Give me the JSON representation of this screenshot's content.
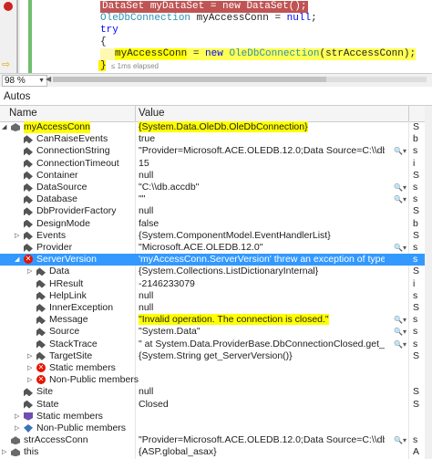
{
  "editor": {
    "line1": {
      "type": "DataSet",
      "rest": " myDataSet = ",
      "kw": "new",
      "type2": " DataSet",
      "end": "();"
    },
    "line2": {
      "type": "OleDbConnection",
      "rest": " myAccessConn = ",
      "kw": "null",
      "end": ";"
    },
    "line3": "try",
    "line4": "{",
    "line5": {
      "var": "myAccessConn",
      "rest": " = ",
      "kw": "new",
      "type": " OleDbConnection",
      "end": "(strAccessConn);"
    },
    "line6": "}",
    "elapsed": "≤ 1ms elapsed"
  },
  "zoom": "98 %",
  "autos": {
    "title": "Autos",
    "columns": {
      "name": "Name",
      "value": "Value"
    },
    "rows": [
      {
        "name": "myAccessConn",
        "value": "{System.Data.OleDb.OleDbConnection}",
        "type": "S",
        "indent": 0,
        "expander": "expanded",
        "icon": "local",
        "name_highlight": true,
        "value_highlight": true
      },
      {
        "name": "CanRaiseEvents",
        "value": "true",
        "type": "b",
        "indent": 1,
        "expander": "none",
        "icon": "prop"
      },
      {
        "name": "ConnectionString",
        "value": "\"Provider=Microsoft.ACE.OLEDB.12.0;Data Source=C:\\\\db.accdb\"",
        "type": "s",
        "indent": 1,
        "expander": "none",
        "icon": "prop",
        "magnifier": true
      },
      {
        "name": "ConnectionTimeout",
        "value": "15",
        "type": "i",
        "indent": 1,
        "expander": "none",
        "icon": "prop"
      },
      {
        "name": "Container",
        "value": "null",
        "type": "S",
        "indent": 1,
        "expander": "none",
        "icon": "prop"
      },
      {
        "name": "DataSource",
        "value": "\"C:\\\\db.accdb\"",
        "type": "s",
        "indent": 1,
        "expander": "none",
        "icon": "prop",
        "magnifier": true
      },
      {
        "name": "Database",
        "value": "\"\"",
        "type": "s",
        "indent": 1,
        "expander": "none",
        "icon": "prop",
        "magnifier": true
      },
      {
        "name": "DbProviderFactory",
        "value": "null",
        "type": "S",
        "indent": 1,
        "expander": "none",
        "icon": "prop"
      },
      {
        "name": "DesignMode",
        "value": "false",
        "type": "b",
        "indent": 1,
        "expander": "none",
        "icon": "prop"
      },
      {
        "name": "Events",
        "value": "{System.ComponentModel.EventHandlerList}",
        "type": "S",
        "indent": 1,
        "expander": "collapsed",
        "icon": "prop"
      },
      {
        "name": "Provider",
        "value": "\"Microsoft.ACE.OLEDB.12.0\"",
        "type": "s",
        "indent": 1,
        "expander": "none",
        "icon": "prop",
        "magnifier": true
      },
      {
        "name": "ServerVersion",
        "value": "'myAccessConn.ServerVersion' threw an exception of type 'System.InvalidOperationException'",
        "type": "s",
        "indent": 1,
        "expander": "expanded",
        "icon": "err",
        "selected": true
      },
      {
        "name": "Data",
        "value": "{System.Collections.ListDictionaryInternal}",
        "type": "S",
        "indent": 2,
        "expander": "collapsed",
        "icon": "prop"
      },
      {
        "name": "HResult",
        "value": "-2146233079",
        "type": "i",
        "indent": 2,
        "expander": "none",
        "icon": "prop"
      },
      {
        "name": "HelpLink",
        "value": "null",
        "type": "s",
        "indent": 2,
        "expander": "none",
        "icon": "prop"
      },
      {
        "name": "InnerException",
        "value": "null",
        "type": "S",
        "indent": 2,
        "expander": "none",
        "icon": "prop"
      },
      {
        "name": "Message",
        "value": "\"Invalid operation. The connection is closed.\"",
        "type": "s",
        "indent": 2,
        "expander": "none",
        "icon": "prop",
        "value_highlight": true,
        "magnifier": true
      },
      {
        "name": "Source",
        "value": "\"System.Data\"",
        "type": "s",
        "indent": 2,
        "expander": "none",
        "icon": "prop",
        "magnifier": true
      },
      {
        "name": "StackTrace",
        "value": "\"   at System.Data.ProviderBase.DbConnectionClosed.get_ServerVersion()\"",
        "type": "s",
        "indent": 2,
        "expander": "none",
        "icon": "prop",
        "magnifier": true
      },
      {
        "name": "TargetSite",
        "value": "{System.String get_ServerVersion()}",
        "type": "S",
        "indent": 2,
        "expander": "collapsed",
        "icon": "prop"
      },
      {
        "name": "Static members",
        "value": "",
        "type": "",
        "indent": 2,
        "expander": "collapsed",
        "icon": "err"
      },
      {
        "name": "Non-Public members",
        "value": "",
        "type": "",
        "indent": 2,
        "expander": "collapsed",
        "icon": "err"
      },
      {
        "name": "Site",
        "value": "null",
        "type": "S",
        "indent": 1,
        "expander": "none",
        "icon": "prop"
      },
      {
        "name": "State",
        "value": "Closed",
        "type": "S",
        "indent": 1,
        "expander": "none",
        "icon": "prop"
      },
      {
        "name": "Static members",
        "value": "",
        "type": "",
        "indent": 1,
        "expander": "collapsed",
        "icon": "static"
      },
      {
        "name": "Non-Public members",
        "value": "",
        "type": "",
        "indent": 1,
        "expander": "collapsed",
        "icon": "obj"
      },
      {
        "name": "strAccessConn",
        "value": "\"Provider=Microsoft.ACE.OLEDB.12.0;Data Source=C:\\\\db.accdb\"",
        "type": "s",
        "indent": 0,
        "expander": "none",
        "icon": "local",
        "magnifier": true
      },
      {
        "name": "this",
        "value": "{ASP.global_asax}",
        "type": "A",
        "indent": 0,
        "expander": "collapsed",
        "icon": "local"
      }
    ]
  }
}
